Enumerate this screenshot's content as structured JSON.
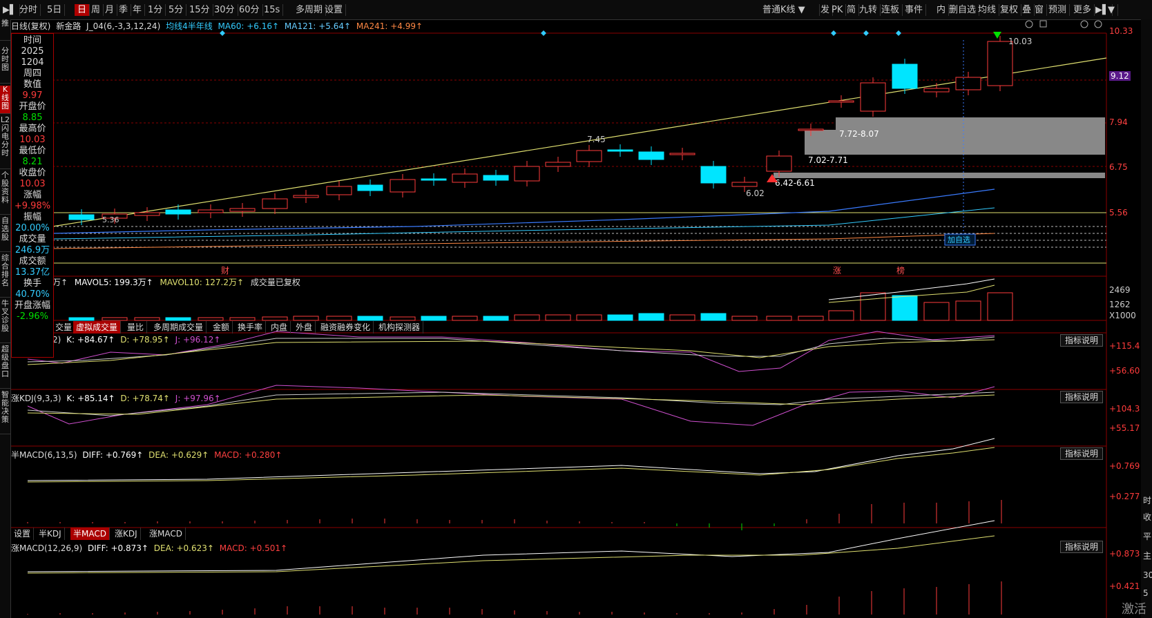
{
  "toolbar": {
    "periods": [
      "分时",
      "5日",
      "日",
      "周",
      "月",
      "季",
      "年",
      "1分",
      "5分",
      "15分",
      "30分",
      "60分",
      "15s",
      "多周期",
      "设置"
    ],
    "selected_period": "日",
    "right_items": [
      "普通K线",
      "发",
      "PK",
      "简",
      "九转",
      "连板",
      "事件",
      "内",
      "删自选",
      "均线",
      "复权",
      "叠",
      "窗",
      "预测",
      "更多"
    ]
  },
  "leftnav": [
    "推",
    "分时图",
    "K线图",
    "L2闪电分时",
    "个股资料",
    "自选股",
    "综合排名",
    "牛叉诊股",
    "超级盘口",
    "智能决策"
  ],
  "leftnav_selected": "K线图",
  "header": {
    "cycle": "日线(复权)",
    "stock": "新金路",
    "indicator": "J_04(6,-3,3,12,24)",
    "ma_label": "均线4半年线",
    "ma60": "MA60: +6.16↑",
    "ma121": "MA121: +5.64↑",
    "ma241": "MA241: +4.99↑"
  },
  "info": {
    "rows": [
      {
        "label": "时间",
        "value": "2025",
        "cls": "wh"
      },
      {
        "label": "",
        "value": "1204",
        "cls": "wh"
      },
      {
        "label": "周四",
        "value": "",
        "cls": "wh"
      },
      {
        "label": "数值",
        "value": "9.97",
        "cls": "up"
      },
      {
        "label": "开盘价",
        "value": "8.85",
        "cls": "dn"
      },
      {
        "label": "最高价",
        "value": "10.03",
        "cls": "up"
      },
      {
        "label": "最低价",
        "value": "8.21",
        "cls": "dn"
      },
      {
        "label": "收盘价",
        "value": "10.03",
        "cls": "up"
      },
      {
        "label": "涨幅",
        "value": "+9.98%",
        "cls": "up"
      },
      {
        "label": "振幅",
        "value": "20.00%",
        "cls": "cy"
      },
      {
        "label": "成交量",
        "value": "246.9万",
        "cls": "cy"
      },
      {
        "label": "成交额",
        "value": "13.37亿",
        "cls": "cy"
      },
      {
        "label": "换手",
        "value": "40.70%",
        "cls": "cy"
      },
      {
        "label": "开盘涨幅",
        "value": "-2.96%",
        "cls": "dn"
      }
    ]
  },
  "price_axis": [
    "10.33",
    "9.12",
    "7.94",
    "6.75",
    "5.56"
  ],
  "price_current": "9.12",
  "annotations": {
    "high": "10.03",
    "peak": "7.45",
    "low": "6.02",
    "low2": "5.36",
    "zone1": "7.72-8.07",
    "zone2": "7.02-7.71",
    "zone3": "6.42-6.61",
    "marker": "财",
    "mark1": "涨",
    "mark2": "榜",
    "add_watch": "加自选"
  },
  "volume": {
    "header_prefix": "万↑",
    "mavol5": "MAVOL5: 199.3万↑",
    "mavol10": "MAVOL10: 127.2万↑",
    "note": "成交量已复权",
    "axis": [
      "2469",
      "1262",
      "X1000"
    ]
  },
  "tabs": [
    "交量",
    "虚拟成交量",
    "量比",
    "多周期成交量",
    "金额",
    "换手率",
    "内盘",
    "外盘",
    "融资融券变化",
    "机构探测器"
  ],
  "tabs_selected": "虚拟成交量",
  "kdj1": {
    "prefix": "2)",
    "k": "K: +84.67↑",
    "d": "D: +78.95↑",
    "j": "J: +96.12↑",
    "axis": [
      "+115.4",
      "+56.60"
    ]
  },
  "kdj2": {
    "name": "涨KDJ(9,3,3)",
    "k": "K: +85.14↑",
    "d": "D: +78.74↑",
    "j": "J: +97.96↑",
    "axis": [
      "+104.3",
      "+55.17"
    ]
  },
  "macd1": {
    "name": "半MACD(6,13,5)",
    "diff": "DIFF: +0.769↑",
    "dea": "DEA: +0.629↑",
    "macd": "MACD: +0.280↑",
    "axis": [
      "+0.769",
      "+0.277"
    ]
  },
  "bottom_tabs": [
    "设置",
    "半KDJ",
    "半MACD",
    "涨KDJ",
    "涨MACD"
  ],
  "bottom_tabs_selected": "半MACD",
  "macd2": {
    "name": "涨MACD(12,26,9)",
    "diff": "DIFF: +0.873↑",
    "dea": "DEA: +0.623↑",
    "macd": "MACD: +0.501↑",
    "axis": [
      "+0.873",
      "+0.421"
    ]
  },
  "explain_label": "指标说明",
  "right_strip": [
    "时",
    "收",
    "平",
    "主",
    "30",
    "5"
  ],
  "watermark": "激活",
  "colors": {
    "up": "#ff3b3b",
    "down": "#00e5ff",
    "ma": "#e0e070",
    "grid": "#8b0000"
  }
}
